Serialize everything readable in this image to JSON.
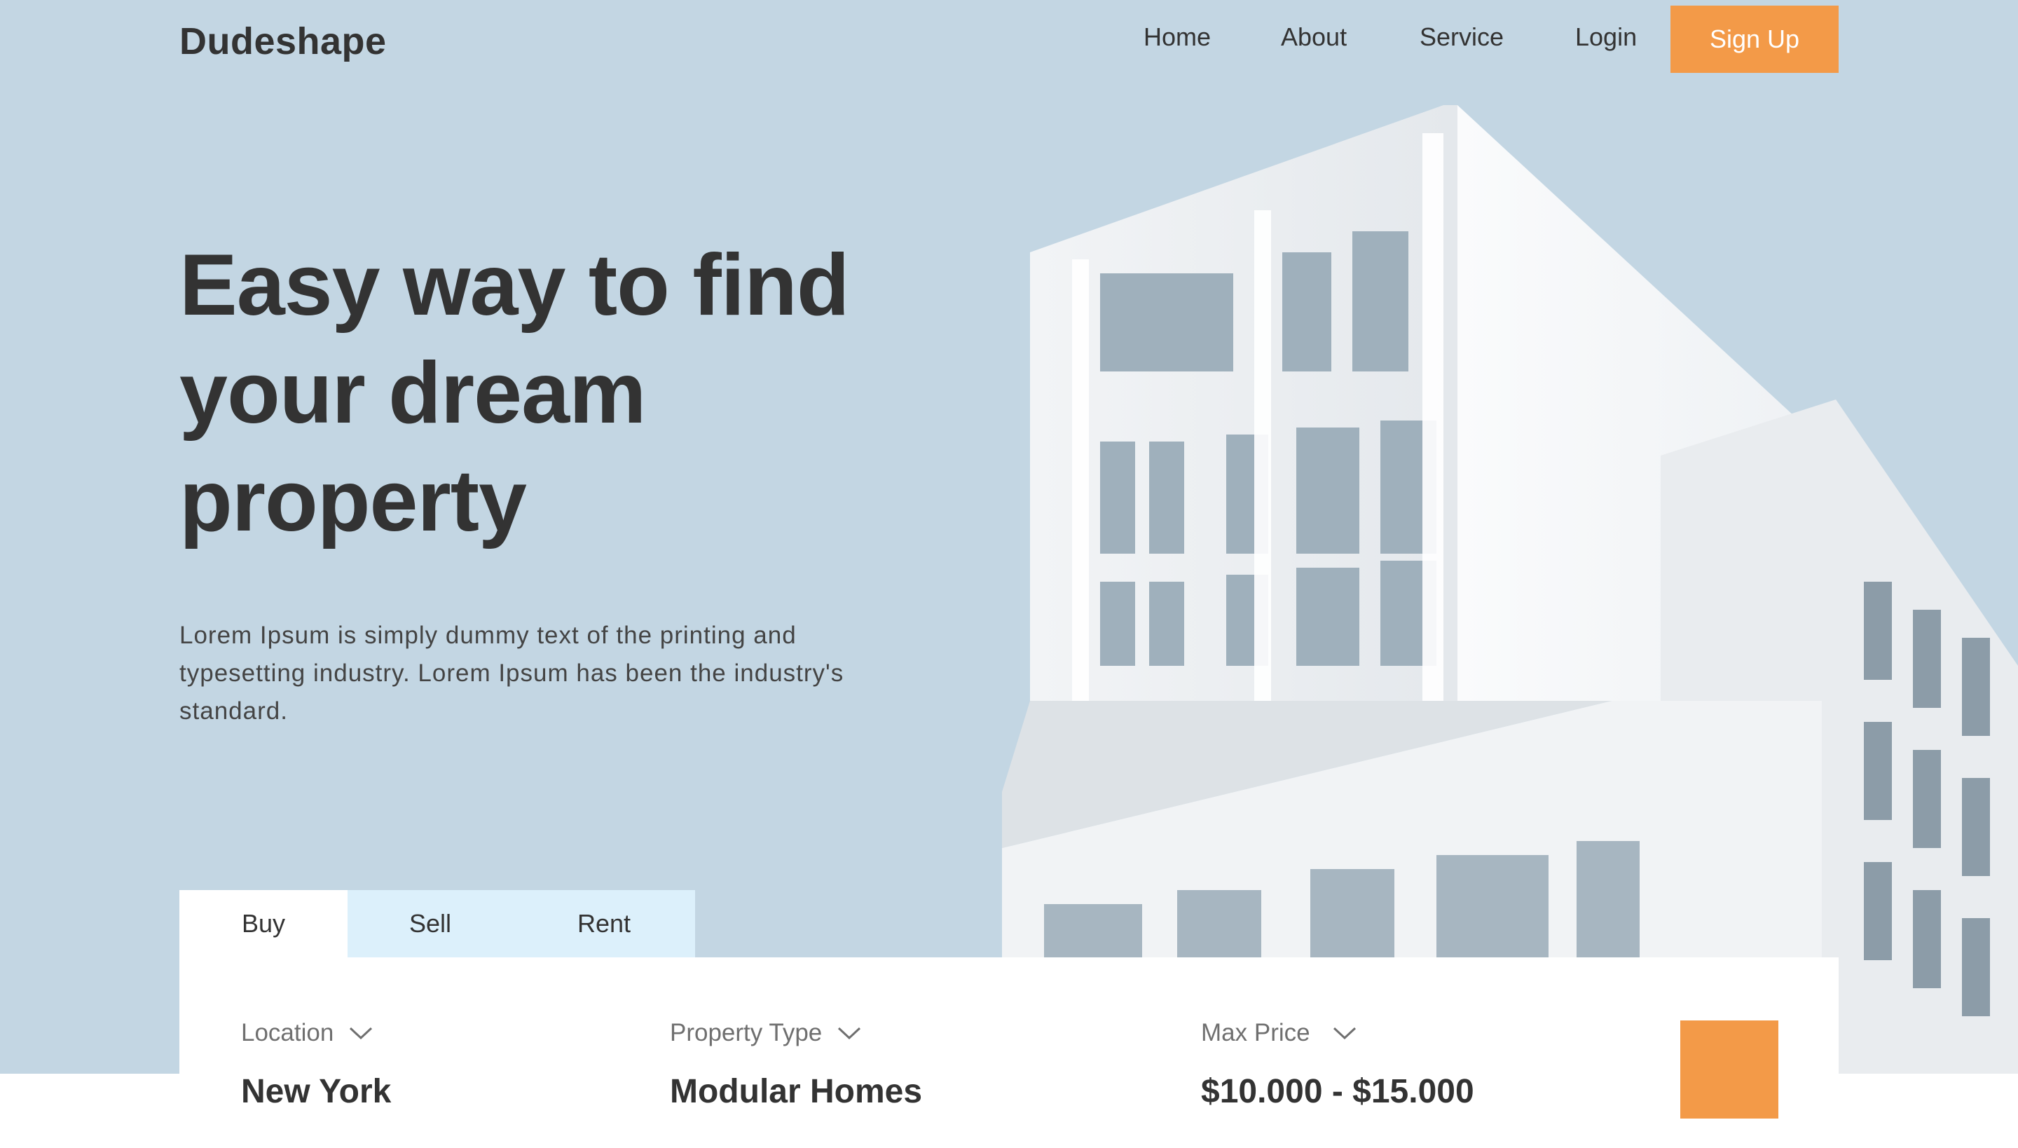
{
  "brand": {
    "name": "Dudeshape"
  },
  "nav": {
    "items": [
      {
        "label": "Home"
      },
      {
        "label": "About"
      },
      {
        "label": "Service"
      },
      {
        "label": "Login"
      }
    ],
    "signup_label": "Sign Up"
  },
  "hero": {
    "headline_lines": [
      "Easy way to find",
      "your dream",
      "property"
    ],
    "description": "Lorem Ipsum is simply dummy text of the printing and typesetting industry. Lorem Ipsum has been the industry's standard."
  },
  "search": {
    "tabs": [
      {
        "label": "Buy",
        "active": true
      },
      {
        "label": "Sell",
        "active": false
      },
      {
        "label": "Rent",
        "active": false
      }
    ],
    "fields": [
      {
        "label": "Location",
        "value": "New York",
        "icon": "chevron-down-icon"
      },
      {
        "label": "Property Type",
        "value": "Modular Homes",
        "icon": "chevron-down-icon"
      },
      {
        "label": "Max Price",
        "value": "$10.000 - $15.000",
        "icon": "chevron-down-icon"
      }
    ]
  },
  "colors": {
    "accent": "#f39a48",
    "hero_background": "#c3d6e3",
    "tab_background": "#dcf0fb",
    "text": "#333333"
  }
}
